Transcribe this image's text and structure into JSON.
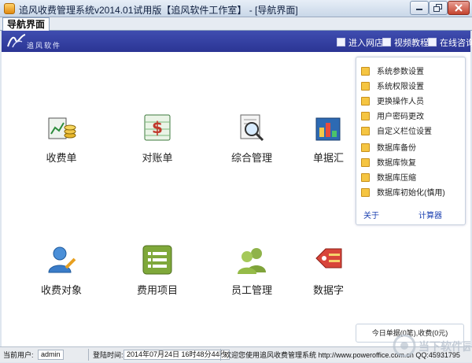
{
  "window": {
    "title": "追风收费管理系统v2014.01试用版【追风软件工作室】 - [导航界面]"
  },
  "tab": {
    "label": "导航界面"
  },
  "banner": {
    "logo_text": "追风软件",
    "links": [
      "进入网店",
      "视频教程",
      "在线咨询"
    ]
  },
  "tiles": {
    "receipt": "收费单",
    "reconcile": "对账单",
    "manage": "综合管理",
    "report": "单据汇",
    "payer": "收费对象",
    "items": "费用项目",
    "staff": "员工管理",
    "dict": "数据字"
  },
  "menu": {
    "items": [
      "系统参数设置",
      "系统权限设置",
      "更换操作人员",
      "用户密码更改",
      "自定义栏位设置",
      "数据库备份",
      "数据库恢复",
      "数据库压缩",
      "数据库初始化(慎用)"
    ],
    "about": "关于",
    "calc": "计算器"
  },
  "summary": "今日单据(0笔),收费(0元)",
  "status": {
    "user_label": "当前用户:",
    "user_value": "admin",
    "login_label": "登陆时间:",
    "login_value": "2014年07月24日 16时48分44秒",
    "welcome": "欢迎您使用追风收费管理系统 http://www.poweroffice.com.cn QQ:45931795"
  },
  "watermark": "当下软件园",
  "colors": {
    "banner": "#3a46a8",
    "menu_icon": "#f5c542",
    "link": "#1a3fb0"
  }
}
